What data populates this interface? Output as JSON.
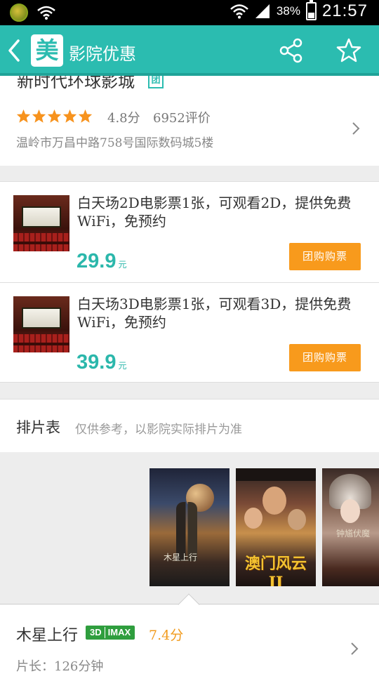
{
  "status_bar": {
    "battery": "38%",
    "time": "21:57",
    "battery_level": 0.38
  },
  "header": {
    "logo": "美",
    "title": "影院优惠",
    "accent_color": "#2bbcb0"
  },
  "cinema": {
    "name": "新时代环球影城",
    "badge": "团",
    "rating_stars": 5,
    "score": "4.8分",
    "reviews": "6952评价",
    "address": "温岭市万昌中路758号国际数码城5楼"
  },
  "deals": [
    {
      "title": "白天场2D电影票1张，可观看2D，提供免费WiFi，免预约",
      "price": "29.9",
      "unit": "元",
      "button": "团购购票"
    },
    {
      "title": "白天场3D电影票1张，可观看3D，提供免费WiFi，免预约",
      "price": "39.9",
      "unit": "元",
      "button": "团购购票"
    }
  ],
  "schedule": {
    "title": "排片表",
    "note": "仅供参考，以影院实际排片为准"
  },
  "posters": [
    {
      "title": "木星上行"
    },
    {
      "title": "澳门风云II"
    },
    {
      "title": "钟馗伏魔"
    }
  ],
  "movie": {
    "name": "木星上行",
    "format_3d": "3D",
    "format_imax": "IMAX",
    "score": "7.4分",
    "duration": "片长：126分钟"
  }
}
